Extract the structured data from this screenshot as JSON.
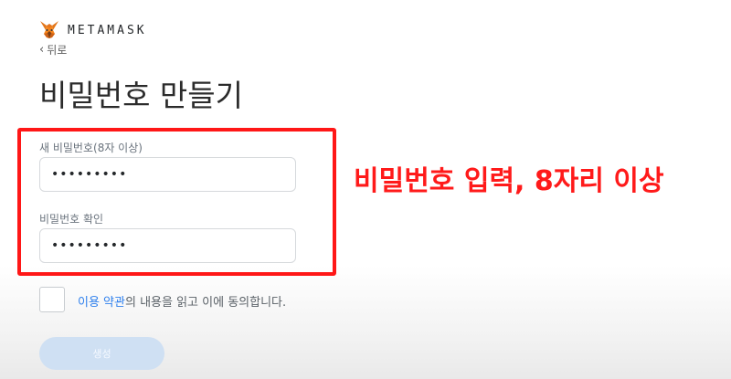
{
  "brand": {
    "name": "METAMASK",
    "logo_icon": "fox-icon"
  },
  "nav": {
    "back_label": "뒤로",
    "back_icon": "chevron-left-icon"
  },
  "page": {
    "title": "비밀번호 만들기"
  },
  "form": {
    "new_password": {
      "label": "새 비밀번호(8자 이상)",
      "value": "•••••••••"
    },
    "confirm_password": {
      "label": "비밀번호 확인",
      "value": "•••••••••"
    }
  },
  "annotation": {
    "text": "비밀번호 입력, 8자리 이상",
    "color": "#ff1a1a"
  },
  "terms": {
    "checked": false,
    "link_text": "이용 약관",
    "rest_text": "의 내용을 읽고 이에 동의합니다."
  },
  "submit": {
    "label": "생성",
    "enabled": false
  },
  "colors": {
    "accent": "#2f80ed",
    "highlight": "#ff1717",
    "button_disabled": "#cfe0f3"
  }
}
